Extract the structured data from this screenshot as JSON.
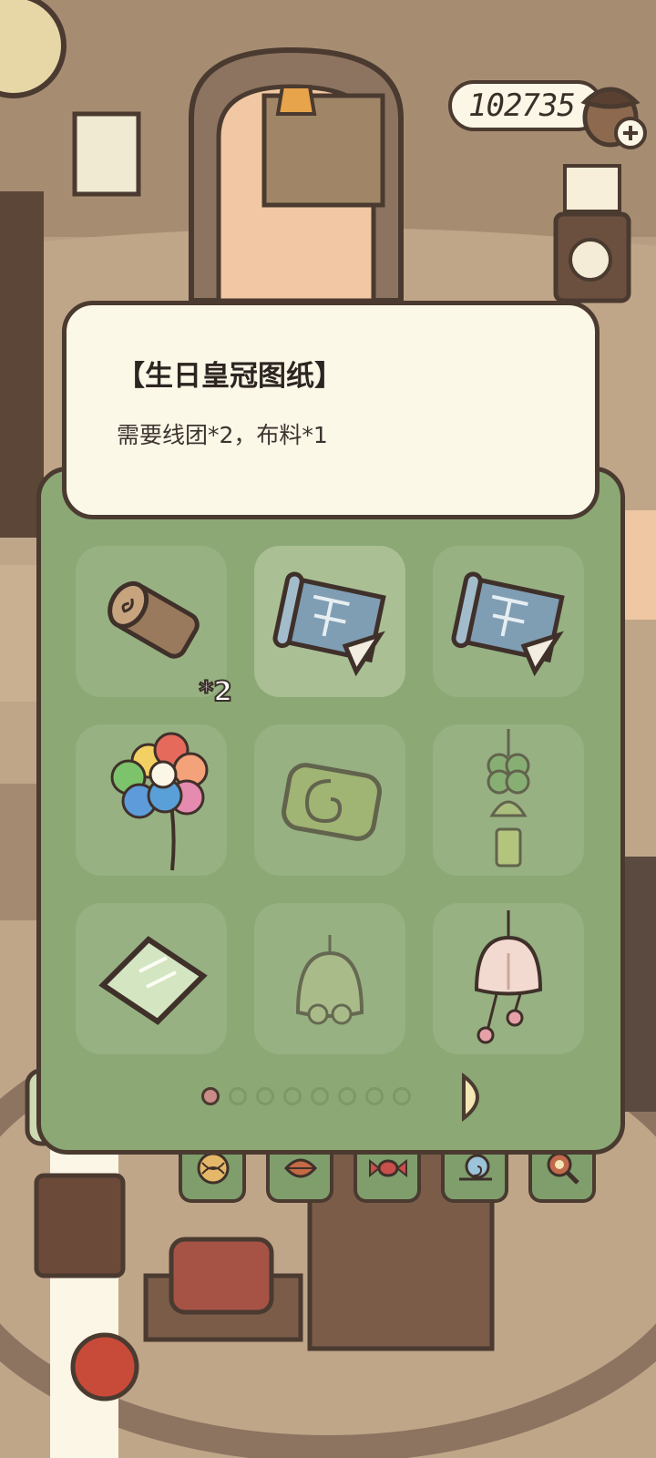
{
  "currency": {
    "amount": "102735"
  },
  "tooltip": {
    "title": "【生日皇冠图纸】",
    "desc": "需要线团*2，布料*1"
  },
  "inventory": {
    "items": [
      {
        "icon": "log-icon",
        "qty": "*2"
      },
      {
        "icon": "blueprint-scroll-icon",
        "qty": ""
      },
      {
        "icon": "blueprint-scroll-icon",
        "qty": ""
      },
      {
        "icon": "rainbow-balloon-icon",
        "qty": ""
      },
      {
        "icon": "spiral-cushion-icon",
        "qty": ""
      },
      {
        "icon": "clover-charm-icon",
        "qty": ""
      },
      {
        "icon": "glass-pane-icon",
        "qty": ""
      },
      {
        "icon": "bell-icon",
        "qty": ""
      },
      {
        "icon": "wind-chime-icon",
        "qty": ""
      }
    ],
    "page_index": 1,
    "page_count": 8
  },
  "tabs": [
    {
      "icon": "yarn-ball-icon"
    },
    {
      "icon": "leaf-icon"
    },
    {
      "icon": "candy-icon"
    },
    {
      "icon": "snail-icon"
    },
    {
      "icon": "magnifier-icon"
    }
  ],
  "colors": {
    "panel": "#8ba875",
    "slot": "#97b182",
    "tooltip": "#fcf8e8",
    "outline": "#4a3a30",
    "active_dot": "#c98c87"
  }
}
